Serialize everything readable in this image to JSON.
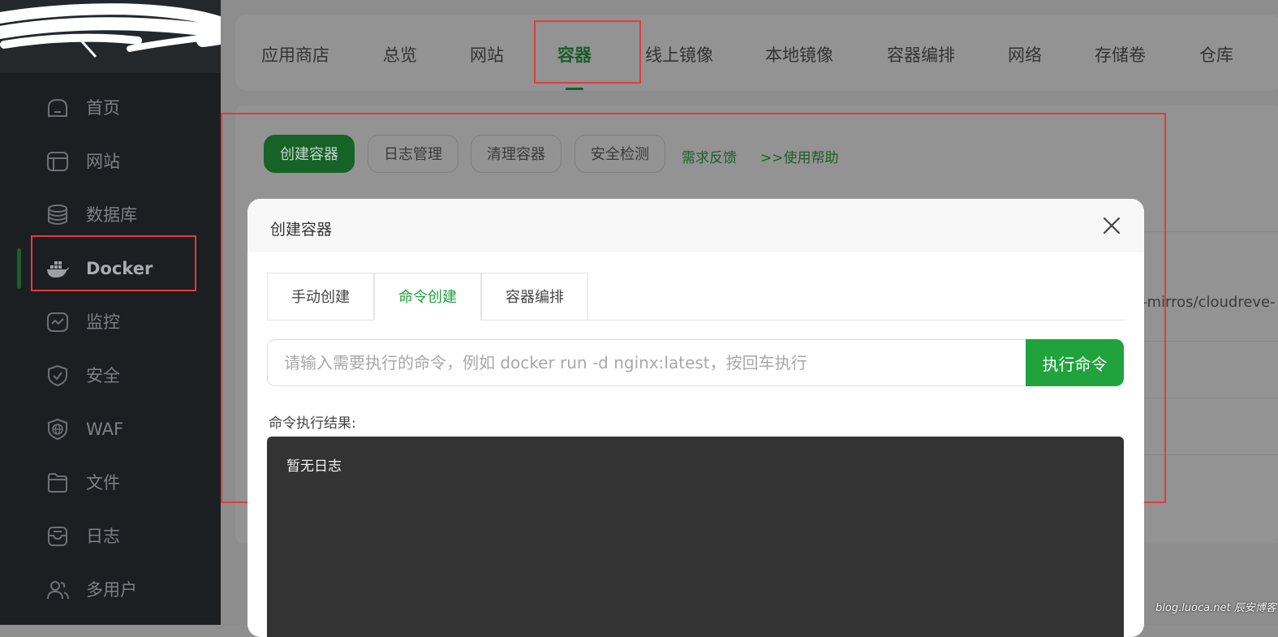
{
  "sidebar": {
    "items": [
      {
        "label": "首页",
        "icon": "home-icon"
      },
      {
        "label": "网站",
        "icon": "website-icon"
      },
      {
        "label": "数据库",
        "icon": "database-icon"
      },
      {
        "label": "Docker",
        "icon": "docker-icon",
        "active": true
      },
      {
        "label": "监控",
        "icon": "monitor-icon"
      },
      {
        "label": "安全",
        "icon": "shield-icon"
      },
      {
        "label": "WAF",
        "icon": "waf-globe-icon"
      },
      {
        "label": "文件",
        "icon": "folder-icon"
      },
      {
        "label": "日志",
        "icon": "log-icon"
      },
      {
        "label": "多用户",
        "icon": "users-icon"
      }
    ]
  },
  "topnav": {
    "tabs": [
      "应用商店",
      "总览",
      "网站",
      "容器",
      "线上镜像",
      "本地镜像",
      "容器编排",
      "网络",
      "存储卷",
      "仓库"
    ],
    "active": "容器"
  },
  "toolbar": {
    "create": "创建容器",
    "logs": "日志管理",
    "clean": "清理容器",
    "security": "安全检测",
    "feedback": "需求反馈",
    "help": ">>使用帮助"
  },
  "background": {
    "row_text": "-mirros/cloudreve-"
  },
  "modal": {
    "title": "创建容器",
    "tabs": [
      "手动创建",
      "命令创建",
      "容器编排"
    ],
    "active_tab": "命令创建",
    "input_placeholder": "请输入需要执行的命令，例如 docker run -d nginx:latest，按回车执行",
    "execute_label": "执行命令",
    "result_label": "命令执行结果:",
    "result_text": "暂无日志"
  },
  "watermark": "blog.luoca.net 辰安博客",
  "colors": {
    "accent": "#20a33d",
    "highlight": "#e23c3c",
    "sidebar_bg": "#1c1f22"
  }
}
